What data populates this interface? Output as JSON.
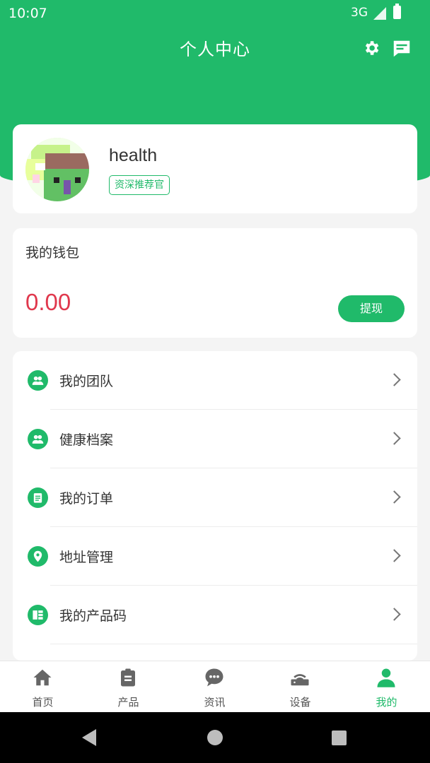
{
  "status_bar": {
    "time": "10:07",
    "network": "3G"
  },
  "header": {
    "title": "个人中心",
    "settings_icon": "gear-icon",
    "message_icon": "chat-icon"
  },
  "profile": {
    "username": "health",
    "badge": "资深推荐官"
  },
  "wallet": {
    "title": "我的钱包",
    "amount": "0.00",
    "withdraw_label": "提现"
  },
  "menu": {
    "items": [
      {
        "label": "我的团队",
        "icon": "team-icon"
      },
      {
        "label": "健康档案",
        "icon": "health-record-icon"
      },
      {
        "label": "我的订单",
        "icon": "order-icon"
      },
      {
        "label": "地址管理",
        "icon": "location-icon"
      },
      {
        "label": "我的产品码",
        "icon": "product-code-icon"
      }
    ]
  },
  "tabbar": {
    "tabs": [
      {
        "label": "首页",
        "icon": "home-icon"
      },
      {
        "label": "产品",
        "icon": "clipboard-icon"
      },
      {
        "label": "资讯",
        "icon": "chat-bubble-icon"
      },
      {
        "label": "设备",
        "icon": "router-icon"
      },
      {
        "label": "我的",
        "icon": "user-icon",
        "active": true
      }
    ]
  },
  "colors": {
    "accent": "#20ba6a",
    "amount": "#e0384d"
  }
}
